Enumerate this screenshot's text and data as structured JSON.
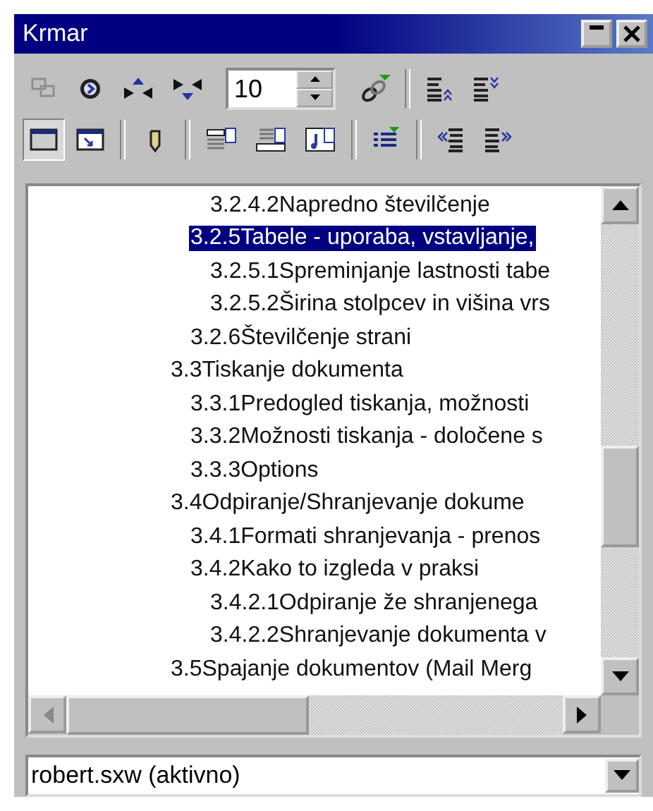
{
  "window": {
    "title": "Krmar"
  },
  "toolbar": {
    "navigation_enabled": false,
    "content_view_on": true,
    "levels": "10"
  },
  "tree": {
    "items": [
      {
        "children": [
          {
            "children": [
              {
                "text": "3.2.4.2Napredno številčenje",
                "selected": false
              }
            ]
          },
          {
            "text": "3.2.5Tabele - uporaba, vstavljanje,",
            "selected": true,
            "children": [
              {
                "text": "3.2.5.1Spreminjanje lastnosti tabe",
                "selected": false
              },
              {
                "text": "3.2.5.2Širina stolpcev in višina vrs",
                "selected": false
              }
            ]
          },
          {
            "text": "3.2.6Številčenje strani",
            "selected": false
          }
        ]
      },
      {
        "text": "3.3Tiskanje dokumenta",
        "selected": false,
        "children": [
          {
            "text": "3.3.1Predogled tiskanja, možnosti",
            "selected": false
          },
          {
            "text": "3.3.2Možnosti tiskanja - določene s",
            "selected": false
          },
          {
            "text": "3.3.3Options",
            "selected": false
          }
        ]
      },
      {
        "text": "3.4Odpiranje/Shranjevanje dokume",
        "selected": false,
        "children": [
          {
            "text": "3.4.1Formati shranjevanja - prenos",
            "selected": false
          },
          {
            "text": "3.4.2Kako to izgleda v praksi",
            "selected": false,
            "children": [
              {
                "text": "3.4.2.1Odpiranje že shranjenega",
                "selected": false
              },
              {
                "text": "3.4.2.2Shranjevanje dokumenta v",
                "selected": false
              }
            ]
          }
        ]
      },
      {
        "text": "3.5Spajanje dokumentov (Mail Merg",
        "selected": false
      }
    ]
  },
  "document_select": {
    "value": "robert.sxw (aktivno)"
  }
}
